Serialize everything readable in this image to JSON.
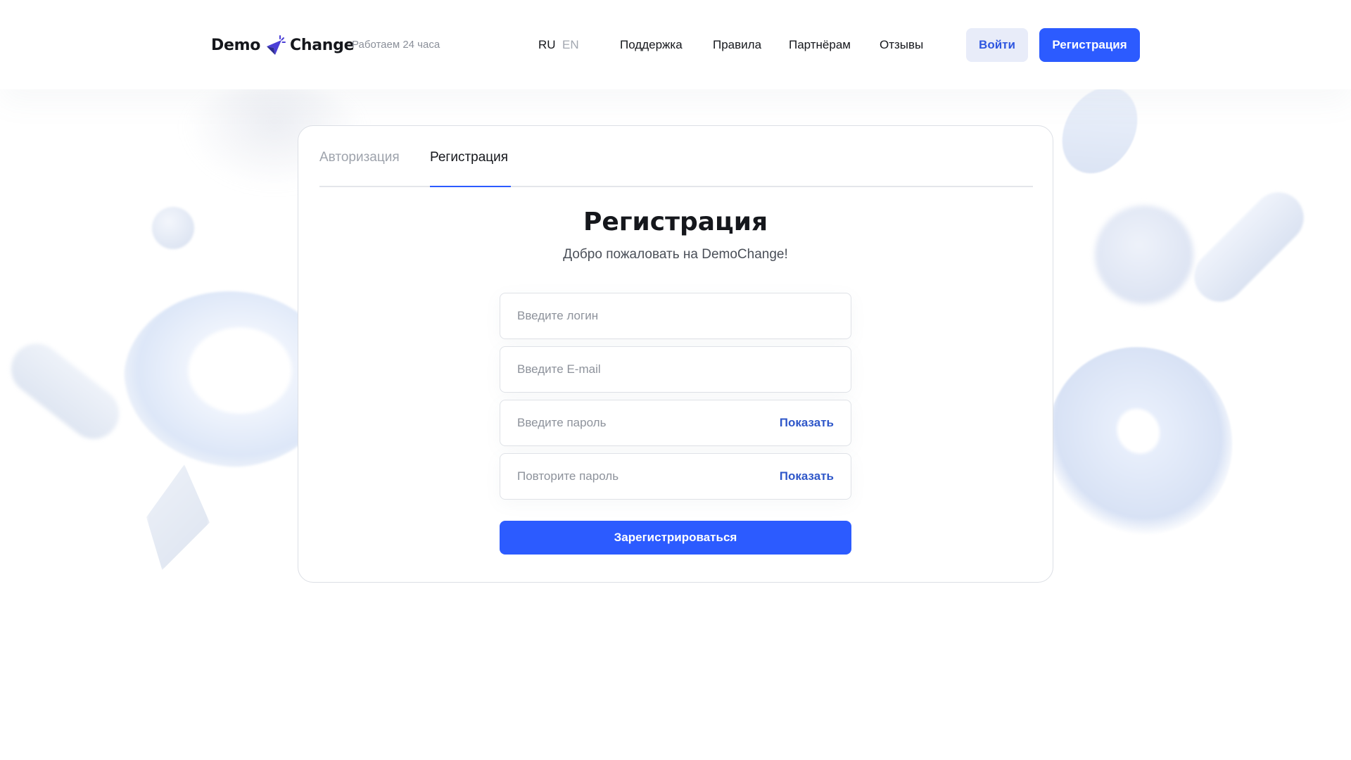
{
  "header": {
    "logo": {
      "left": "Demo",
      "right": "Change"
    },
    "tagline": "Работаем 24 часа",
    "languages": [
      "RU",
      "EN"
    ],
    "nav": [
      "Поддержка",
      "Правила",
      "Партнёрам",
      "Отзывы"
    ],
    "login_label": "Войти",
    "register_label": "Регистрация"
  },
  "card": {
    "tabs": [
      "Авторизация",
      "Регистрация"
    ],
    "active_tab": "Регистрация",
    "title": "Регистрация",
    "subtitle": "Добро пожаловать на DemoChange!",
    "fields": {
      "login": {
        "placeholder": "Введите логин",
        "value": ""
      },
      "email": {
        "placeholder": "Введите E-mail",
        "value": ""
      },
      "password": {
        "placeholder": "Введите пароль",
        "value": "",
        "show_label": "Показать"
      },
      "password_repeat": {
        "placeholder": "Повторите пароль",
        "value": "",
        "show_label": "Показать"
      }
    },
    "submit_label": "Зарегистрироваться"
  },
  "colors": {
    "accent": "#2c5bff",
    "accent_soft": "#e8ecf9",
    "link": "#2f57c9",
    "text": "#15171c",
    "muted": "#8d929b"
  }
}
